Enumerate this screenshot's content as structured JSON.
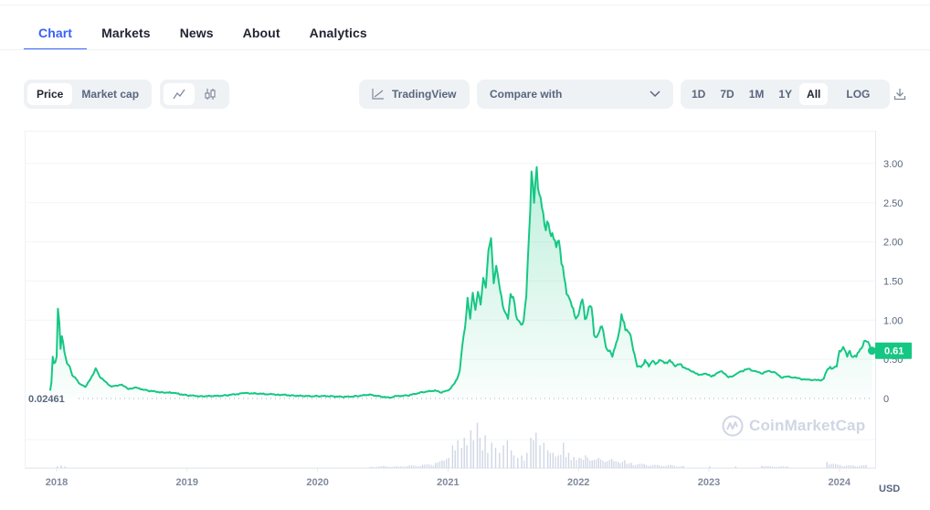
{
  "tabs": [
    {
      "label": "Chart",
      "active": true
    },
    {
      "label": "Markets",
      "active": false
    },
    {
      "label": "News",
      "active": false
    },
    {
      "label": "About",
      "active": false
    },
    {
      "label": "Analytics",
      "active": false
    }
  ],
  "toolbar": {
    "metric_toggle": [
      {
        "label": "Price",
        "active": true
      },
      {
        "label": "Market cap",
        "active": false
      }
    ],
    "chart_type_toggle": [
      {
        "icon": "line-chart-icon",
        "active": true
      },
      {
        "icon": "candlestick-icon",
        "active": false
      }
    ],
    "tradingview_label": "TradingView",
    "compare_label": "Compare with",
    "ranges": [
      {
        "label": "1D",
        "active": false
      },
      {
        "label": "7D",
        "active": false
      },
      {
        "label": "1M",
        "active": false
      },
      {
        "label": "1Y",
        "active": false
      },
      {
        "label": "All",
        "active": true
      }
    ],
    "log_label": "LOG",
    "download_icon": "download-icon"
  },
  "colors": {
    "accent": "#3861fb",
    "line": "#16c784",
    "negative": "#ea3943",
    "axis_text": "#58667e",
    "volume": "#cfd6e4"
  },
  "watermark": "CoinMarketCap",
  "currency_label": "USD",
  "chart_data": {
    "type": "area",
    "title": "",
    "xlabel": "",
    "ylabel": "",
    "x_ticks": [
      "2018",
      "2019",
      "2020",
      "2021",
      "2022",
      "2023",
      "2024"
    ],
    "y_ticks": [
      "0",
      "0.50",
      "1.00",
      "1.50",
      "2.00",
      "2.50",
      "3.00"
    ],
    "ylim": [
      0,
      3.4
    ],
    "xlim": [
      2017.75,
      2024.3
    ],
    "grid": true,
    "baseline_label": "0.02461",
    "baseline_value": 0.02461,
    "current_price_label": "0.61",
    "current_price": 0.61,
    "series": [
      {
        "name": "Price",
        "points": [
          [
            2017.95,
            0.1
          ],
          [
            2017.96,
            0.2
          ],
          [
            2017.97,
            0.55
          ],
          [
            2017.98,
            0.45
          ],
          [
            2017.99,
            0.45
          ],
          [
            2018.0,
            0.55
          ],
          [
            2018.01,
            1.15
          ],
          [
            2018.02,
            0.95
          ],
          [
            2018.03,
            0.65
          ],
          [
            2018.04,
            0.8
          ],
          [
            2018.05,
            0.7
          ],
          [
            2018.06,
            0.6
          ],
          [
            2018.08,
            0.45
          ],
          [
            2018.1,
            0.4
          ],
          [
            2018.12,
            0.3
          ],
          [
            2018.15,
            0.25
          ],
          [
            2018.18,
            0.18
          ],
          [
            2018.22,
            0.15
          ],
          [
            2018.26,
            0.25
          ],
          [
            2018.3,
            0.38
          ],
          [
            2018.33,
            0.28
          ],
          [
            2018.37,
            0.22
          ],
          [
            2018.42,
            0.15
          ],
          [
            2018.5,
            0.18
          ],
          [
            2018.55,
            0.12
          ],
          [
            2018.6,
            0.14
          ],
          [
            2018.7,
            0.1
          ],
          [
            2018.8,
            0.08
          ],
          [
            2018.9,
            0.07
          ],
          [
            2019.0,
            0.04
          ],
          [
            2019.1,
            0.03
          ],
          [
            2019.2,
            0.03
          ],
          [
            2019.3,
            0.04
          ],
          [
            2019.45,
            0.07
          ],
          [
            2019.55,
            0.06
          ],
          [
            2019.7,
            0.05
          ],
          [
            2019.8,
            0.04
          ],
          [
            2019.9,
            0.03
          ],
          [
            2020.0,
            0.03
          ],
          [
            2020.1,
            0.03
          ],
          [
            2020.2,
            0.02
          ],
          [
            2020.3,
            0.03
          ],
          [
            2020.4,
            0.05
          ],
          [
            2020.5,
            0.02
          ],
          [
            2020.55,
            0.01
          ],
          [
            2020.6,
            0.03
          ],
          [
            2020.7,
            0.04
          ],
          [
            2020.8,
            0.08
          ],
          [
            2020.9,
            0.1
          ],
          [
            2020.95,
            0.08
          ],
          [
            2021.0,
            0.1
          ],
          [
            2021.03,
            0.15
          ],
          [
            2021.05,
            0.2
          ],
          [
            2021.07,
            0.25
          ],
          [
            2021.09,
            0.35
          ],
          [
            2021.11,
            0.7
          ],
          [
            2021.13,
            0.9
          ],
          [
            2021.15,
            1.25
          ],
          [
            2021.17,
            1.05
          ],
          [
            2021.19,
            1.35
          ],
          [
            2021.21,
            1.1
          ],
          [
            2021.23,
            1.4
          ],
          [
            2021.25,
            1.2
          ],
          [
            2021.27,
            1.5
          ],
          [
            2021.29,
            1.45
          ],
          [
            2021.31,
            1.9
          ],
          [
            2021.33,
            2.0
          ],
          [
            2021.35,
            1.5
          ],
          [
            2021.37,
            1.7
          ],
          [
            2021.39,
            1.45
          ],
          [
            2021.42,
            1.2
          ],
          [
            2021.44,
            1.1
          ],
          [
            2021.46,
            1.0
          ],
          [
            2021.48,
            1.35
          ],
          [
            2021.5,
            1.3
          ],
          [
            2021.53,
            1.0
          ],
          [
            2021.56,
            0.95
          ],
          [
            2021.58,
            1.0
          ],
          [
            2021.6,
            1.3
          ],
          [
            2021.62,
            2.05
          ],
          [
            2021.64,
            2.9
          ],
          [
            2021.66,
            2.5
          ],
          [
            2021.68,
            2.95
          ],
          [
            2021.7,
            2.6
          ],
          [
            2021.72,
            2.45
          ],
          [
            2021.74,
            2.2
          ],
          [
            2021.76,
            2.25
          ],
          [
            2021.79,
            2.1
          ],
          [
            2021.82,
            2.0
          ],
          [
            2021.85,
            2.0
          ],
          [
            2021.87,
            1.75
          ],
          [
            2021.9,
            1.45
          ],
          [
            2021.92,
            1.3
          ],
          [
            2021.95,
            1.2
          ],
          [
            2021.97,
            1.05
          ],
          [
            2022.0,
            1.05
          ],
          [
            2022.03,
            1.3
          ],
          [
            2022.05,
            1.0
          ],
          [
            2022.08,
            1.15
          ],
          [
            2022.1,
            1.2
          ],
          [
            2022.12,
            0.8
          ],
          [
            2022.15,
            0.8
          ],
          [
            2022.18,
            0.95
          ],
          [
            2022.21,
            0.65
          ],
          [
            2022.24,
            0.6
          ],
          [
            2022.26,
            0.55
          ],
          [
            2022.3,
            0.75
          ],
          [
            2022.33,
            1.05
          ],
          [
            2022.36,
            0.9
          ],
          [
            2022.4,
            0.8
          ],
          [
            2022.43,
            0.55
          ],
          [
            2022.45,
            0.42
          ],
          [
            2022.48,
            0.4
          ],
          [
            2022.51,
            0.48
          ],
          [
            2022.54,
            0.42
          ],
          [
            2022.57,
            0.48
          ],
          [
            2022.6,
            0.44
          ],
          [
            2022.63,
            0.5
          ],
          [
            2022.66,
            0.45
          ],
          [
            2022.7,
            0.48
          ],
          [
            2022.74,
            0.42
          ],
          [
            2022.78,
            0.44
          ],
          [
            2022.82,
            0.38
          ],
          [
            2022.86,
            0.36
          ],
          [
            2022.9,
            0.32
          ],
          [
            2022.94,
            0.3
          ],
          [
            2022.98,
            0.32
          ],
          [
            2023.02,
            0.28
          ],
          [
            2023.06,
            0.32
          ],
          [
            2023.1,
            0.35
          ],
          [
            2023.15,
            0.27
          ],
          [
            2023.2,
            0.3
          ],
          [
            2023.25,
            0.35
          ],
          [
            2023.3,
            0.38
          ],
          [
            2023.35,
            0.35
          ],
          [
            2023.4,
            0.32
          ],
          [
            2023.45,
            0.35
          ],
          [
            2023.5,
            0.34
          ],
          [
            2023.55,
            0.27
          ],
          [
            2023.6,
            0.28
          ],
          [
            2023.65,
            0.27
          ],
          [
            2023.7,
            0.25
          ],
          [
            2023.75,
            0.24
          ],
          [
            2023.8,
            0.24
          ],
          [
            2023.85,
            0.23
          ],
          [
            2023.88,
            0.25
          ],
          [
            2023.9,
            0.35
          ],
          [
            2023.93,
            0.4
          ],
          [
            2023.95,
            0.38
          ],
          [
            2023.98,
            0.42
          ],
          [
            2024.0,
            0.6
          ],
          [
            2024.03,
            0.65
          ],
          [
            2024.06,
            0.55
          ],
          [
            2024.08,
            0.6
          ],
          [
            2024.1,
            0.52
          ],
          [
            2024.13,
            0.55
          ],
          [
            2024.16,
            0.62
          ],
          [
            2024.19,
            0.72
          ],
          [
            2024.21,
            0.75
          ],
          [
            2024.23,
            0.68
          ],
          [
            2024.25,
            0.61
          ]
        ]
      }
    ],
    "volume": [
      [
        2018.0,
        0.03
      ],
      [
        2018.03,
        0.05
      ],
      [
        2018.06,
        0.03
      ],
      [
        2020.4,
        0.02
      ],
      [
        2020.5,
        0.04
      ],
      [
        2020.6,
        0.03
      ],
      [
        2020.7,
        0.05
      ],
      [
        2020.8,
        0.06
      ],
      [
        2020.9,
        0.1
      ],
      [
        2020.95,
        0.15
      ],
      [
        2021.0,
        0.2
      ],
      [
        2021.03,
        0.45
      ],
      [
        2021.05,
        0.35
      ],
      [
        2021.07,
        0.55
      ],
      [
        2021.1,
        0.4
      ],
      [
        2021.12,
        0.6
      ],
      [
        2021.14,
        0.45
      ],
      [
        2021.17,
        0.75
      ],
      [
        2021.19,
        0.55
      ],
      [
        2021.22,
        0.9
      ],
      [
        2021.24,
        0.6
      ],
      [
        2021.26,
        0.35
      ],
      [
        2021.28,
        0.65
      ],
      [
        2021.3,
        0.3
      ],
      [
        2021.33,
        0.5
      ],
      [
        2021.36,
        0.4
      ],
      [
        2021.39,
        0.3
      ],
      [
        2021.42,
        0.45
      ],
      [
        2021.45,
        0.55
      ],
      [
        2021.48,
        0.35
      ],
      [
        2021.5,
        0.25
      ],
      [
        2021.53,
        0.2
      ],
      [
        2021.56,
        0.25
      ],
      [
        2021.6,
        0.3
      ],
      [
        2021.63,
        0.6
      ],
      [
        2021.65,
        0.55
      ],
      [
        2021.67,
        0.7
      ],
      [
        2021.7,
        0.45
      ],
      [
        2021.73,
        0.5
      ],
      [
        2021.76,
        0.35
      ],
      [
        2021.8,
        0.3
      ],
      [
        2021.84,
        0.25
      ],
      [
        2021.88,
        0.5
      ],
      [
        2021.92,
        0.3
      ],
      [
        2021.96,
        0.22
      ],
      [
        2022.0,
        0.2
      ],
      [
        2022.05,
        0.25
      ],
      [
        2022.1,
        0.15
      ],
      [
        2022.15,
        0.2
      ],
      [
        2022.2,
        0.12
      ],
      [
        2022.25,
        0.18
      ],
      [
        2022.3,
        0.12
      ],
      [
        2022.35,
        0.15
      ],
      [
        2022.4,
        0.1
      ],
      [
        2022.5,
        0.08
      ],
      [
        2022.6,
        0.06
      ],
      [
        2022.7,
        0.06
      ],
      [
        2022.8,
        0.04
      ],
      [
        2023.0,
        0.03
      ],
      [
        2023.2,
        0.03
      ],
      [
        2023.4,
        0.04
      ],
      [
        2023.6,
        0.03
      ],
      [
        2023.9,
        0.12
      ],
      [
        2024.0,
        0.06
      ],
      [
        2024.1,
        0.05
      ],
      [
        2024.2,
        0.06
      ]
    ]
  }
}
